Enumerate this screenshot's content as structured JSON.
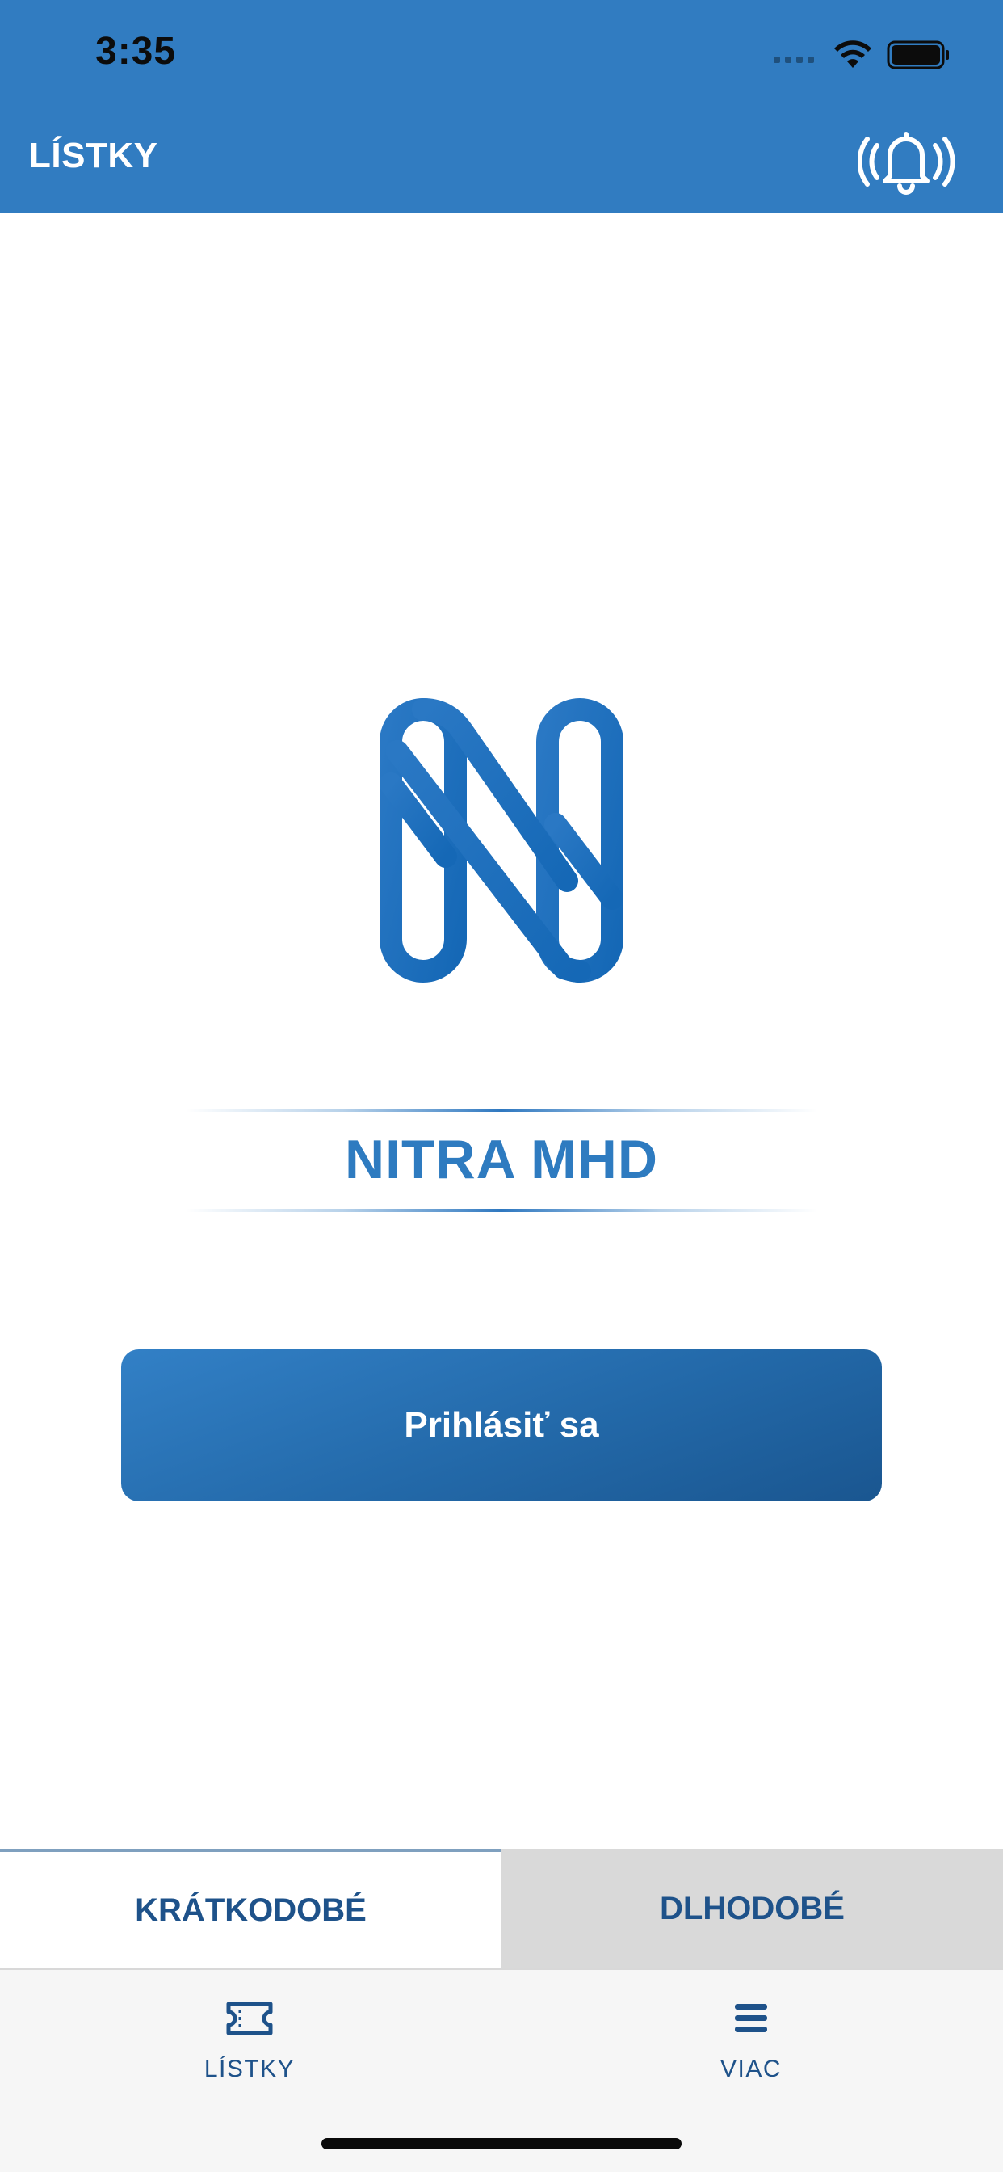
{
  "status_bar": {
    "time": "3:35"
  },
  "header": {
    "title": "LÍSTKY",
    "bell_icon": "bell-ringing-icon"
  },
  "brand": {
    "app_name": "NITRA MHD",
    "logo_letter": "N",
    "accent_color": "#317cc1"
  },
  "login": {
    "label": "Prihlásiť sa"
  },
  "segments": [
    {
      "label": "KRÁTKODOBÉ",
      "active": true
    },
    {
      "label": "DLHODOBÉ",
      "active": false
    }
  ],
  "tabbar": {
    "items": [
      {
        "label": "LÍSTKY",
        "icon": "ticket-icon"
      },
      {
        "label": "VIAC",
        "icon": "menu-icon"
      }
    ]
  }
}
